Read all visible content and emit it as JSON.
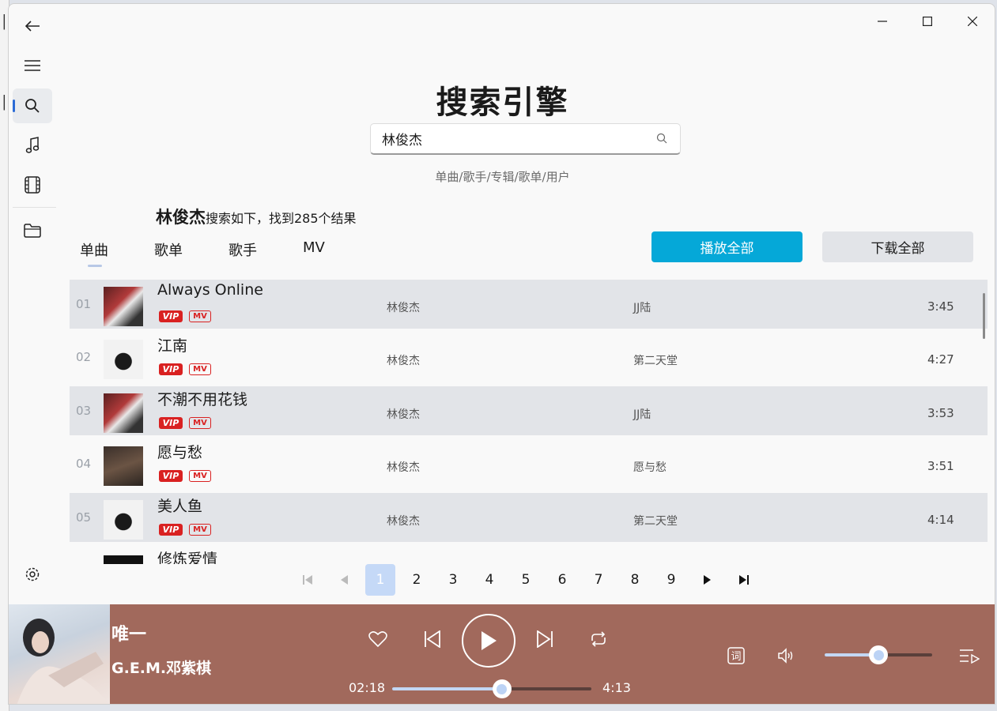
{
  "header": {
    "title": "搜索引擎",
    "hint": "单曲/歌手/专辑/歌单/用户"
  },
  "search": {
    "value": "林俊杰",
    "placeholder": ""
  },
  "result": {
    "keyword": "林俊杰",
    "summary": "搜索如下，找到285个结果"
  },
  "tabs": [
    {
      "label": "单曲",
      "active": true
    },
    {
      "label": "歌单"
    },
    {
      "label": "歌手"
    },
    {
      "label": "MV"
    }
  ],
  "actions": {
    "play_all": "播放全部",
    "download_all": "下载全部"
  },
  "songs": [
    {
      "num": "01",
      "name": "Always Online",
      "artist": "林俊杰",
      "album": "JJ陆",
      "duration": "3:45",
      "vip": "VIP",
      "mv": "MV"
    },
    {
      "num": "02",
      "name": "江南",
      "artist": "林俊杰",
      "album": "第二天堂",
      "duration": "4:27",
      "vip": "VIP",
      "mv": "MV"
    },
    {
      "num": "03",
      "name": "不潮不用花钱",
      "artist": "林俊杰",
      "album": "JJ陆",
      "duration": "3:53",
      "vip": "VIP",
      "mv": "MV"
    },
    {
      "num": "04",
      "name": "愿与愁",
      "artist": "林俊杰",
      "album": "愿与愁",
      "duration": "3:51",
      "vip": "VIP",
      "mv": "MV"
    },
    {
      "num": "05",
      "name": "美人鱼",
      "artist": "林俊杰",
      "album": "第二天堂",
      "duration": "4:14",
      "vip": "VIP",
      "mv": "MV"
    },
    {
      "num": "",
      "name": "修炼爱情",
      "artist": "",
      "album": "",
      "duration": "",
      "vip": "",
      "mv": ""
    }
  ],
  "pagination": {
    "pages": [
      "1",
      "2",
      "3",
      "4",
      "5",
      "6",
      "7",
      "8",
      "9"
    ],
    "current": "1"
  },
  "player": {
    "title": "唯一",
    "artist": "G.E.M.邓紫棋",
    "elapsed": "02:18",
    "total": "4:13",
    "progress": 0.55,
    "volume": 0.5,
    "lyrics_icon_glyph": "词"
  },
  "colors": {
    "accent": "#05a8d8",
    "player_bg": "#a1695c",
    "row_shade": "#e2e4e8",
    "vip_red": "#d92121"
  },
  "icons": [
    "back-arrow-icon",
    "menu-icon",
    "search-icon",
    "music-note-icon",
    "film-icon",
    "folder-icon",
    "settings-icon",
    "heart-icon",
    "previous-icon",
    "play-icon",
    "next-icon",
    "repeat-icon",
    "lyrics-icon",
    "volume-icon",
    "playlist-icon"
  ]
}
